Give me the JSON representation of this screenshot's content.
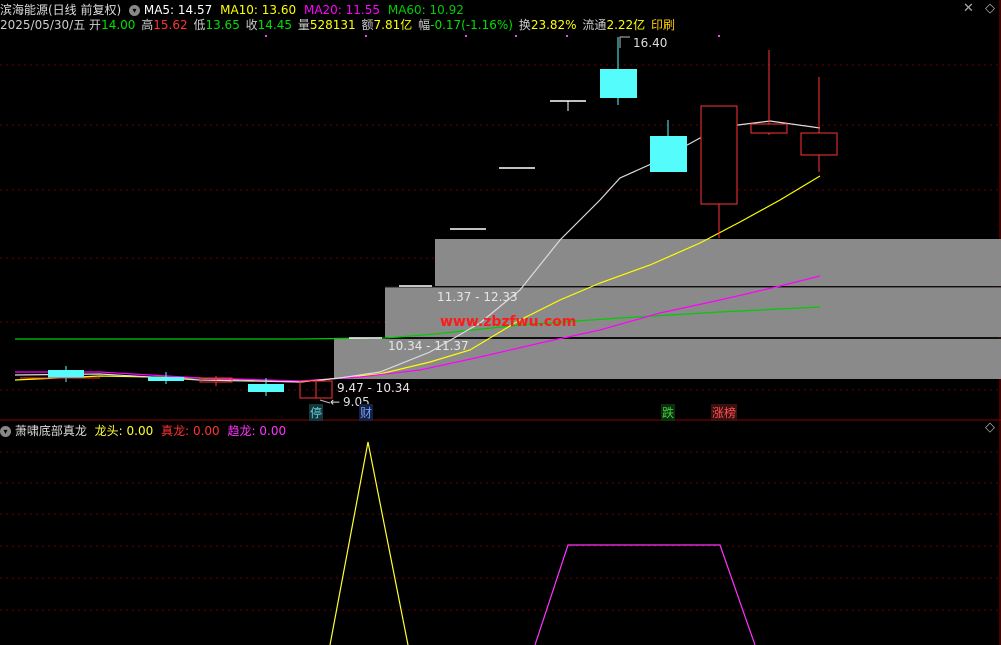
{
  "header": {
    "stock_name": "滨海能源(日线 前复权)",
    "ma5": "MA5: 14.57",
    "ma10": "MA10: 13.60",
    "ma20": "MA20: 11.55",
    "ma60": "MA60: 10.92",
    "date": "2025/05/30/五",
    "open_label": "开",
    "open": "14.00",
    "high_label": "高",
    "high": "15.62",
    "low_label": "低",
    "low": "13.65",
    "close_label": "收",
    "close": "14.45",
    "volume_label": "量",
    "volume": "528131",
    "amount_label": "额",
    "amount": "7.81亿",
    "change_label": "幅",
    "change": "-0.17(-1.16%)",
    "turnover_label": "换",
    "turnover": "23.82%",
    "float_label": "流通",
    "float": "2.22亿",
    "print_label": "印刷"
  },
  "chart": {
    "high_annotation": "16.40",
    "low_annotation": "9.05",
    "zones": [
      {
        "label": "11.37 - 12.33"
      },
      {
        "label": "10.34 - 11.37"
      },
      {
        "label": "9.47 - 10.34"
      }
    ],
    "event_tags": [
      {
        "text": "停",
        "color": "#5fd4e0"
      },
      {
        "text": "财",
        "color": "#5f8fff"
      },
      {
        "text": "跌",
        "color": "#39d439"
      },
      {
        "text": "涨榜",
        "color": "#ff4040"
      }
    ],
    "watermark": "www.zbzfwu.com"
  },
  "indicator": {
    "name": "萧啸底部真龙",
    "dragon_head_label": "龙头:",
    "dragon_head": "0.00",
    "true_dragon_label": "真龙:",
    "true_dragon": "0.00",
    "trend_dragon_label": "趋龙:",
    "trend_dragon": "0.00"
  },
  "colors": {
    "up": "#ff3333",
    "down": "#54fcfc",
    "ma5": "#ffffff",
    "ma10": "#ffff00",
    "ma20": "#ff00ff",
    "ma60": "#00cc00",
    "zone": "#8a8a8a"
  }
}
